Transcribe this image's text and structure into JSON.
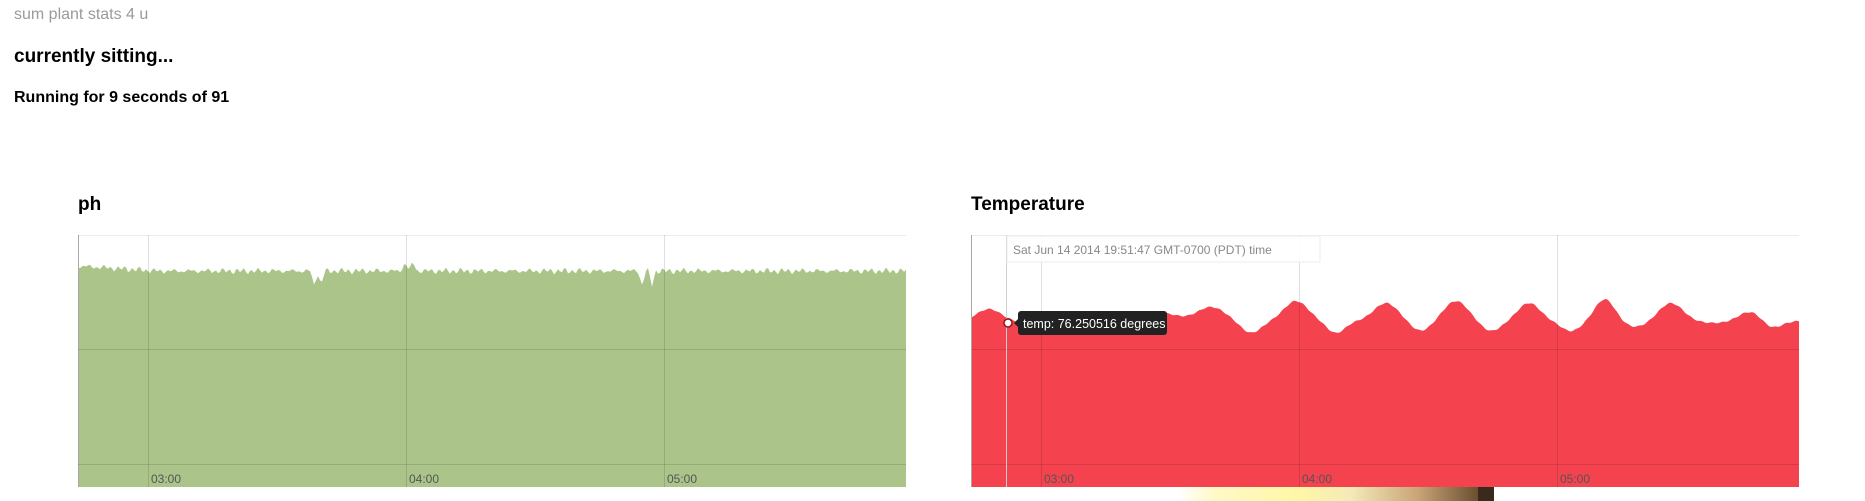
{
  "header": {
    "site_title": "sum plant stats 4 u",
    "status_heading": "currently sitting...",
    "running_line": "Running for 9 seconds of 91"
  },
  "colors": {
    "ph_fill": "#abc489",
    "temperature_fill": "#f4434f",
    "grid": "#dcdcdc"
  },
  "chart_data": [
    {
      "type": "area",
      "title": "ph",
      "x_tick_labels": [
        "03:00",
        "04:00",
        "05:00"
      ],
      "grid": true
    },
    {
      "type": "area",
      "title": "Temperature",
      "x_tick_labels": [
        "03:00",
        "04:00",
        "05:00"
      ],
      "grid": true,
      "hover_time": "Sat Jun 14 2014 19:51:47 GMT-0700 (PDT) time",
      "tooltip": "temp: 76.250516 degrees",
      "series": [
        {
          "name": "temp",
          "hovered_value": 76.250516
        }
      ]
    }
  ]
}
